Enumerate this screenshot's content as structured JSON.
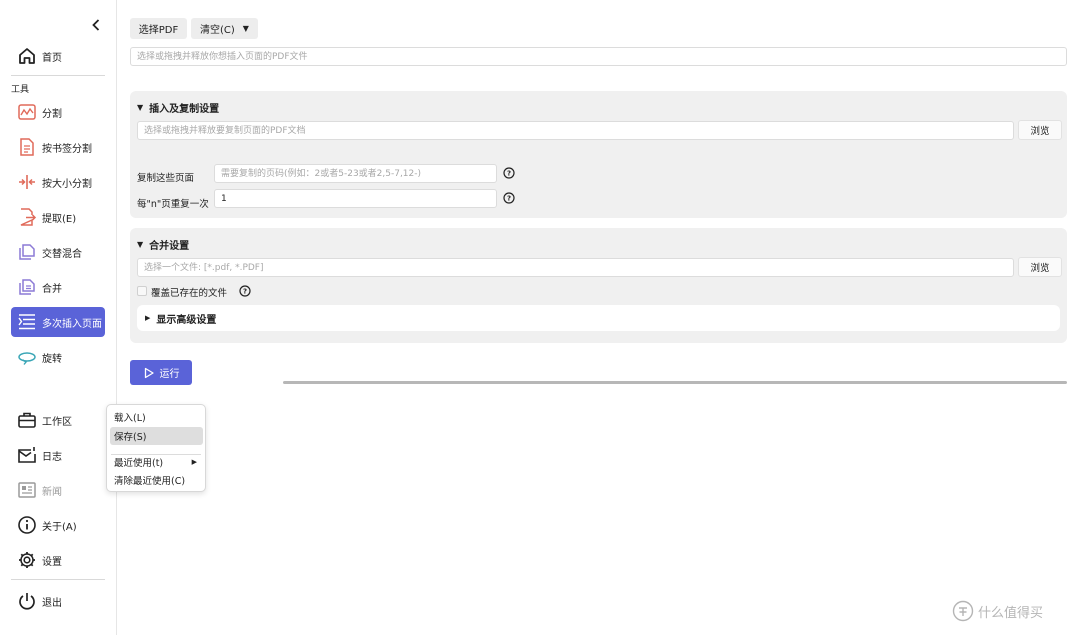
{
  "sidebar": {
    "home": "首页",
    "tools_section": "工具",
    "items": [
      {
        "label": "分割",
        "icon": "split-chart-icon"
      },
      {
        "label": "按书签分割",
        "icon": "bookmark-split-icon"
      },
      {
        "label": "按大小分割",
        "icon": "size-split-icon"
      },
      {
        "label": "提取(E)",
        "icon": "extract-icon"
      },
      {
        "label": "交替混合",
        "icon": "alternate-mix-icon"
      },
      {
        "label": "合并",
        "icon": "merge-icon"
      },
      {
        "label": "多次插入页面",
        "icon": "multi-insert-icon"
      },
      {
        "label": "旋转",
        "icon": "rotate-icon"
      }
    ],
    "workspace": "工作区",
    "log": "日志",
    "news": "新闻",
    "about": "关于(A)",
    "settings": "设置",
    "exit": "退出"
  },
  "toolbar": {
    "select_pdf": "选择PDF",
    "clear": "清空(C)"
  },
  "main": {
    "input_placeholder": "选择或拖拽并释放你想插入页面的PDF文件"
  },
  "insert_panel": {
    "title": "插入及复制设置",
    "source_placeholder": "选择或拖拽并释放要复制页面的PDF文档",
    "browse": "浏览",
    "copy_pages_label": "复制这些页面",
    "copy_pages_placeholder": "需要复制的页码(例如：2或者5-23或者2,5-7,12-)",
    "repeat_label": "每\"n\"页重复一次",
    "repeat_value": "1"
  },
  "merge_panel": {
    "title": "合并设置",
    "file_placeholder": "选择一个文件: [*.pdf, *.PDF]",
    "browse": "浏览",
    "overwrite_label": "覆盖已存在的文件",
    "advanced": "显示高级设置"
  },
  "run": {
    "label": "运行",
    "progress": 0
  },
  "context_menu": {
    "load": "载入(L)",
    "save": "保存(S)",
    "recent": "最近使用(t)",
    "clear_recent": "清除最近使用(C)"
  },
  "watermark": {
    "text": "什么值得买"
  },
  "colors": {
    "accent": "#5a63d8",
    "panel": "#f0f0f0"
  }
}
